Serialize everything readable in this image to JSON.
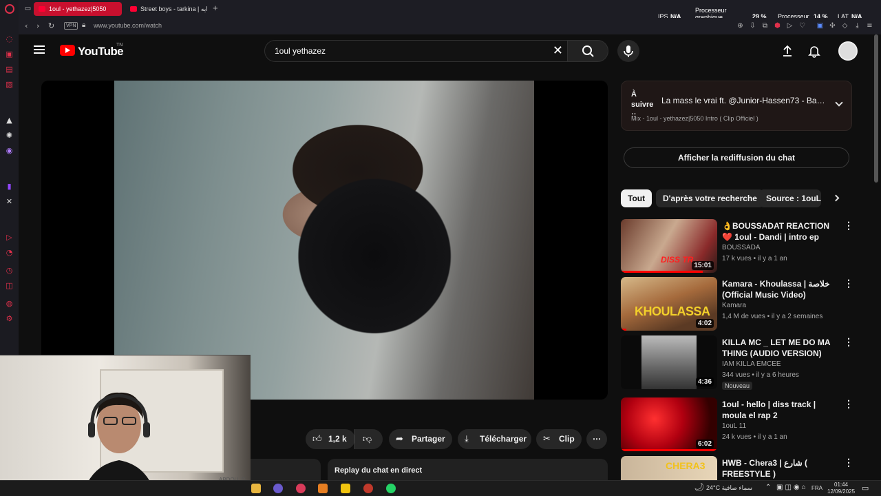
{
  "browser": {
    "tabs": [
      {
        "label": "1oul - yethazez|5050"
      },
      {
        "label": "Street boys - tarkina | ایه"
      }
    ],
    "new_tab": "+",
    "vpn_label": "VPN",
    "url": "www.youtube.com/watch",
    "stats": {
      "ips_label": "IPS",
      "ips_value": "N/A",
      "gpu_label_1": "Processeur",
      "gpu_label_2": "graphique",
      "gpu_value": "29 %",
      "cpu_label": "Processeur",
      "cpu_value": "14 %",
      "lat_label": "LAT",
      "lat_value": "N/A"
    }
  },
  "youtube": {
    "logo_text": "YouTube",
    "logo_region": "TN",
    "search_value": "1oul yethazez"
  },
  "actions": {
    "likes": "1,2 k",
    "share": "Partager",
    "download": "Télécharger",
    "clip": "Clip",
    "more": "⋯"
  },
  "chat": {
    "replay_bar": "Replay du chat en direct",
    "replay_button": "Afficher la rediffusion du chat"
  },
  "up_next": {
    "label": "À suivre ::",
    "title": "La mass le vrai ft. @Junior-Hassen73 - Barr...",
    "subtitle": "Mix - 1oul - yethazez|5050 Intro ( Clip Officiel )"
  },
  "chips": [
    "Tout",
    "D'après votre recherche",
    "Source : 1ouL 1"
  ],
  "recommendations": [
    {
      "title": "👌BOUSSADAT REACTION ❤️ 1oul - Dandi | intro ep islami ...",
      "channel": "BOUSSADA",
      "meta": "17 k vues • il y a 1 an",
      "duration": "15:01",
      "badge": "",
      "thumb_text": "DISS TR",
      "progress": 0.85
    },
    {
      "title": "Kamara - Khoulassa | خلاصة (Official Music Video)",
      "channel": "Kamara",
      "meta": "1,4 M de vues • il y a 2 semaines",
      "duration": "4:02",
      "badge": "",
      "thumb_text": "KHOULASSA",
      "progress": 0.06
    },
    {
      "title": "KILLA MC _ LET ME DO MA THING (AUDIO VERSION)",
      "channel": "IAM KILLA EMCEE",
      "meta": "344 vues • il y a 6 heures",
      "duration": "4:36",
      "badge": "Nouveau",
      "thumb_text": "",
      "progress": 0
    },
    {
      "title": "1oul - hello | diss track | moula el rap 2",
      "channel": "1ouL 11",
      "meta": "24 k vues • il y a 1 an",
      "duration": "6:02",
      "badge": "",
      "thumb_text": "",
      "progress": 1
    },
    {
      "title": "HWB - Chera3 | شارع ( FREESTYLE )",
      "channel": "",
      "meta": "",
      "duration": "",
      "badge": "",
      "thumb_text": "CHERA3",
      "progress": 0
    }
  ],
  "webcam": {
    "watermark": "ABDOU_D"
  },
  "taskbar": {
    "weather": "24°C  سماء صافية",
    "lang": "FRA",
    "time": "01:44",
    "date": "12/09/2025"
  },
  "colors": {
    "accent": "#ff0000",
    "opera_red": "#c8102e"
  }
}
